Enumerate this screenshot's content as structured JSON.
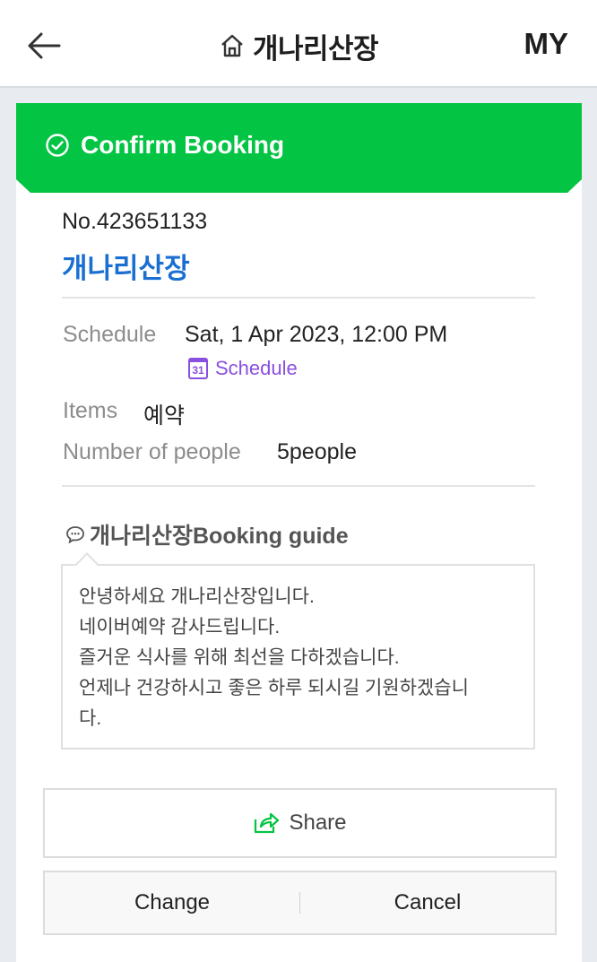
{
  "header": {
    "title": "개나리산장",
    "my_label": "MY",
    "back_icon": "back-arrow-icon",
    "home_icon": "home-icon"
  },
  "banner": {
    "label": "Confirm Booking",
    "icon": "check-circle-icon",
    "color": "#03c443"
  },
  "booking": {
    "number": "No.423651133",
    "place": "개나리산장",
    "schedule_label": "Schedule",
    "schedule_value": "Sat, 1 Apr 2023, 12:00 PM",
    "schedule_link": "Schedule",
    "calendar_icon_text": "31",
    "items_label": "Items",
    "items_value": "예약",
    "people_label": "Number of people",
    "people_value": "5people"
  },
  "guide": {
    "title": "개나리산장Booking guide",
    "lines": [
      "안녕하세요 개나리산장입니다.",
      "네이버예약 감사드립니다.",
      "즐거운 식사를 위해 최선을 다하겠습니다.",
      "언제나 건강하시고 좋은 하루 되시길 기원하겠습니",
      "다."
    ]
  },
  "actions": {
    "share": "Share",
    "change": "Change",
    "cancel": "Cancel"
  },
  "colors": {
    "accent_green": "#03c443",
    "link_blue": "#1a6fd1",
    "schedule_purple": "#8a4fe0"
  }
}
